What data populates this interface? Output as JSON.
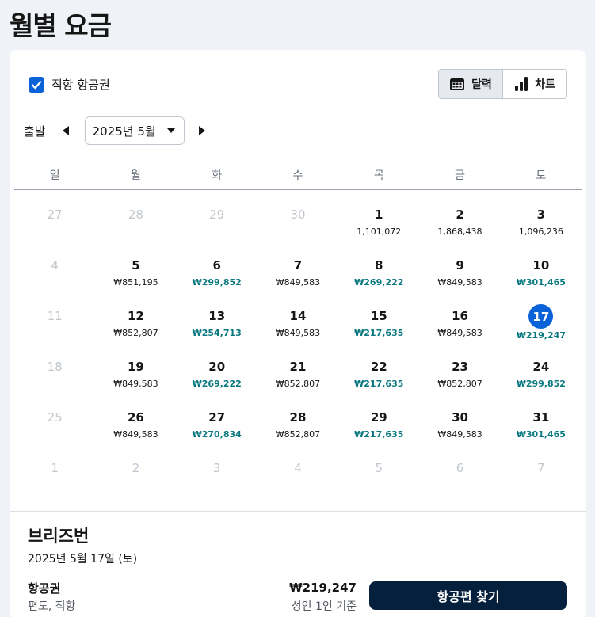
{
  "page": {
    "title": "월별 요금"
  },
  "filter": {
    "direct_label": "직항 항공권",
    "direct_checked": true
  },
  "view_toggle": {
    "calendar_label": "달력",
    "chart_label": "차트",
    "active": "calendar"
  },
  "nav": {
    "depart_label": "출발",
    "month_value": "2025년 5월"
  },
  "weekdays": [
    "일",
    "월",
    "화",
    "수",
    "목",
    "금",
    "토"
  ],
  "weeks": [
    [
      {
        "day": "27",
        "price": "",
        "out": true
      },
      {
        "day": "28",
        "price": "",
        "out": true
      },
      {
        "day": "29",
        "price": "",
        "out": true
      },
      {
        "day": "30",
        "price": "",
        "out": true
      },
      {
        "day": "1",
        "price": "1,101,072"
      },
      {
        "day": "2",
        "price": "1,868,438"
      },
      {
        "day": "3",
        "price": "1,096,236"
      }
    ],
    [
      {
        "day": "4",
        "price": "",
        "out": true
      },
      {
        "day": "5",
        "price": "₩851,195"
      },
      {
        "day": "6",
        "price": "₩299,852",
        "cheap": true
      },
      {
        "day": "7",
        "price": "₩849,583"
      },
      {
        "day": "8",
        "price": "₩269,222",
        "cheap": true
      },
      {
        "day": "9",
        "price": "₩849,583"
      },
      {
        "day": "10",
        "price": "₩301,465",
        "cheap": true
      }
    ],
    [
      {
        "day": "11",
        "price": "",
        "out": true
      },
      {
        "day": "12",
        "price": "₩852,807"
      },
      {
        "day": "13",
        "price": "₩254,713",
        "cheap": true
      },
      {
        "day": "14",
        "price": "₩849,583"
      },
      {
        "day": "15",
        "price": "₩217,635",
        "cheap": true
      },
      {
        "day": "16",
        "price": "₩849,583"
      },
      {
        "day": "17",
        "price": "₩219,247",
        "cheap": true,
        "selected": true
      }
    ],
    [
      {
        "day": "18",
        "price": "",
        "out": true
      },
      {
        "day": "19",
        "price": "₩849,583"
      },
      {
        "day": "20",
        "price": "₩269,222",
        "cheap": true
      },
      {
        "day": "21",
        "price": "₩852,807"
      },
      {
        "day": "22",
        "price": "₩217,635",
        "cheap": true
      },
      {
        "day": "23",
        "price": "₩852,807"
      },
      {
        "day": "24",
        "price": "₩299,852",
        "cheap": true
      }
    ],
    [
      {
        "day": "25",
        "price": "",
        "out": true
      },
      {
        "day": "26",
        "price": "₩849,583"
      },
      {
        "day": "27",
        "price": "₩270,834",
        "cheap": true
      },
      {
        "day": "28",
        "price": "₩852,807"
      },
      {
        "day": "29",
        "price": "₩217,635",
        "cheap": true
      },
      {
        "day": "30",
        "price": "₩849,583"
      },
      {
        "day": "31",
        "price": "₩301,465",
        "cheap": true
      }
    ],
    [
      {
        "day": "1",
        "price": "",
        "out": true
      },
      {
        "day": "2",
        "price": "",
        "out": true
      },
      {
        "day": "3",
        "price": "",
        "out": true
      },
      {
        "day": "4",
        "price": "",
        "out": true
      },
      {
        "day": "5",
        "price": "",
        "out": true
      },
      {
        "day": "6",
        "price": "",
        "out": true
      },
      {
        "day": "7",
        "price": "",
        "out": true
      }
    ]
  ],
  "summary": {
    "destination": "브리즈번",
    "date": "2025년 5월 17일 (토)",
    "fare_label": "항공권",
    "fare_sub": "편도, 직항",
    "price": "₩219,247",
    "basis": "성인 1인 기준",
    "button_label": "항공편 찾기"
  },
  "colors": {
    "accent": "#0a62d8",
    "cheap": "#08787f",
    "button": "#05203c",
    "muted": "#c2c7cd"
  }
}
